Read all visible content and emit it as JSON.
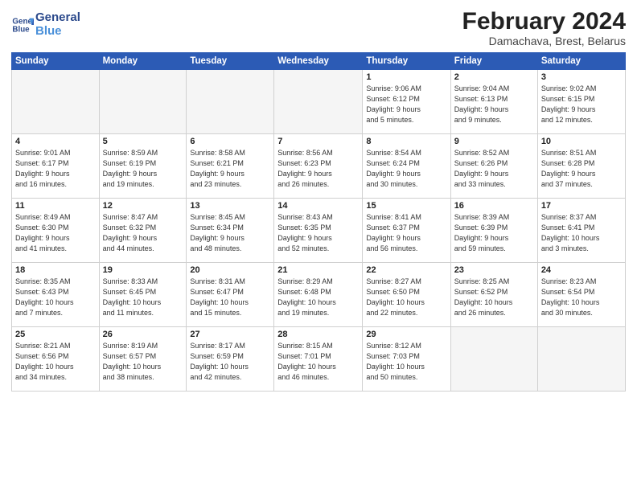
{
  "header": {
    "logo_line1": "General",
    "logo_line2": "Blue",
    "month_year": "February 2024",
    "location": "Damachava, Brest, Belarus"
  },
  "days_of_week": [
    "Sunday",
    "Monday",
    "Tuesday",
    "Wednesday",
    "Thursday",
    "Friday",
    "Saturday"
  ],
  "weeks": [
    [
      {
        "day": "",
        "info": ""
      },
      {
        "day": "",
        "info": ""
      },
      {
        "day": "",
        "info": ""
      },
      {
        "day": "",
        "info": ""
      },
      {
        "day": "1",
        "info": "Sunrise: 9:06 AM\nSunset: 6:12 PM\nDaylight: 9 hours\nand 5 minutes."
      },
      {
        "day": "2",
        "info": "Sunrise: 9:04 AM\nSunset: 6:13 PM\nDaylight: 9 hours\nand 9 minutes."
      },
      {
        "day": "3",
        "info": "Sunrise: 9:02 AM\nSunset: 6:15 PM\nDaylight: 9 hours\nand 12 minutes."
      }
    ],
    [
      {
        "day": "4",
        "info": "Sunrise: 9:01 AM\nSunset: 6:17 PM\nDaylight: 9 hours\nand 16 minutes."
      },
      {
        "day": "5",
        "info": "Sunrise: 8:59 AM\nSunset: 6:19 PM\nDaylight: 9 hours\nand 19 minutes."
      },
      {
        "day": "6",
        "info": "Sunrise: 8:58 AM\nSunset: 6:21 PM\nDaylight: 9 hours\nand 23 minutes."
      },
      {
        "day": "7",
        "info": "Sunrise: 8:56 AM\nSunset: 6:23 PM\nDaylight: 9 hours\nand 26 minutes."
      },
      {
        "day": "8",
        "info": "Sunrise: 8:54 AM\nSunset: 6:24 PM\nDaylight: 9 hours\nand 30 minutes."
      },
      {
        "day": "9",
        "info": "Sunrise: 8:52 AM\nSunset: 6:26 PM\nDaylight: 9 hours\nand 33 minutes."
      },
      {
        "day": "10",
        "info": "Sunrise: 8:51 AM\nSunset: 6:28 PM\nDaylight: 9 hours\nand 37 minutes."
      }
    ],
    [
      {
        "day": "11",
        "info": "Sunrise: 8:49 AM\nSunset: 6:30 PM\nDaylight: 9 hours\nand 41 minutes."
      },
      {
        "day": "12",
        "info": "Sunrise: 8:47 AM\nSunset: 6:32 PM\nDaylight: 9 hours\nand 44 minutes."
      },
      {
        "day": "13",
        "info": "Sunrise: 8:45 AM\nSunset: 6:34 PM\nDaylight: 9 hours\nand 48 minutes."
      },
      {
        "day": "14",
        "info": "Sunrise: 8:43 AM\nSunset: 6:35 PM\nDaylight: 9 hours\nand 52 minutes."
      },
      {
        "day": "15",
        "info": "Sunrise: 8:41 AM\nSunset: 6:37 PM\nDaylight: 9 hours\nand 56 minutes."
      },
      {
        "day": "16",
        "info": "Sunrise: 8:39 AM\nSunset: 6:39 PM\nDaylight: 9 hours\nand 59 minutes."
      },
      {
        "day": "17",
        "info": "Sunrise: 8:37 AM\nSunset: 6:41 PM\nDaylight: 10 hours\nand 3 minutes."
      }
    ],
    [
      {
        "day": "18",
        "info": "Sunrise: 8:35 AM\nSunset: 6:43 PM\nDaylight: 10 hours\nand 7 minutes."
      },
      {
        "day": "19",
        "info": "Sunrise: 8:33 AM\nSunset: 6:45 PM\nDaylight: 10 hours\nand 11 minutes."
      },
      {
        "day": "20",
        "info": "Sunrise: 8:31 AM\nSunset: 6:47 PM\nDaylight: 10 hours\nand 15 minutes."
      },
      {
        "day": "21",
        "info": "Sunrise: 8:29 AM\nSunset: 6:48 PM\nDaylight: 10 hours\nand 19 minutes."
      },
      {
        "day": "22",
        "info": "Sunrise: 8:27 AM\nSunset: 6:50 PM\nDaylight: 10 hours\nand 22 minutes."
      },
      {
        "day": "23",
        "info": "Sunrise: 8:25 AM\nSunset: 6:52 PM\nDaylight: 10 hours\nand 26 minutes."
      },
      {
        "day": "24",
        "info": "Sunrise: 8:23 AM\nSunset: 6:54 PM\nDaylight: 10 hours\nand 30 minutes."
      }
    ],
    [
      {
        "day": "25",
        "info": "Sunrise: 8:21 AM\nSunset: 6:56 PM\nDaylight: 10 hours\nand 34 minutes."
      },
      {
        "day": "26",
        "info": "Sunrise: 8:19 AM\nSunset: 6:57 PM\nDaylight: 10 hours\nand 38 minutes."
      },
      {
        "day": "27",
        "info": "Sunrise: 8:17 AM\nSunset: 6:59 PM\nDaylight: 10 hours\nand 42 minutes."
      },
      {
        "day": "28",
        "info": "Sunrise: 8:15 AM\nSunset: 7:01 PM\nDaylight: 10 hours\nand 46 minutes."
      },
      {
        "day": "29",
        "info": "Sunrise: 8:12 AM\nSunset: 7:03 PM\nDaylight: 10 hours\nand 50 minutes."
      },
      {
        "day": "",
        "info": ""
      },
      {
        "day": "",
        "info": ""
      }
    ]
  ]
}
